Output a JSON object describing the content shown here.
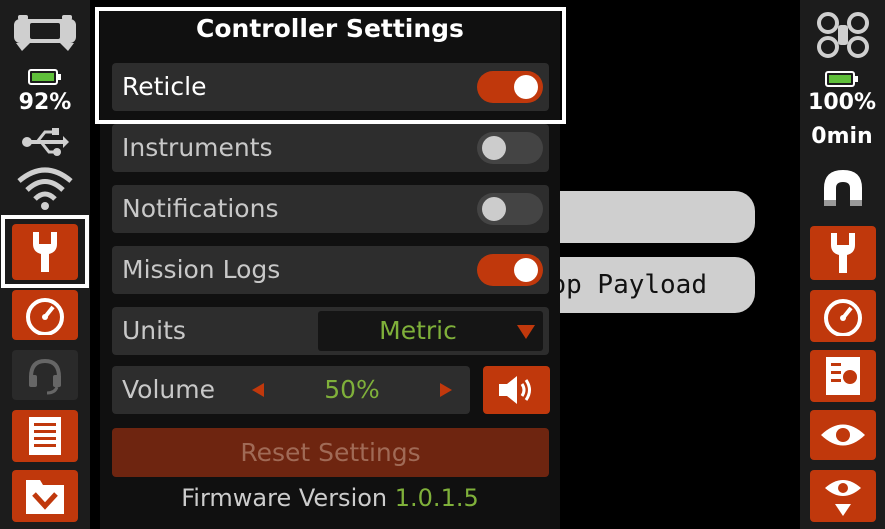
{
  "background": {
    "pill_label": "op Payload"
  },
  "left_bar": {
    "battery_percent": "92%"
  },
  "right_bar": {
    "battery_percent": "100%",
    "flight_time": "0min"
  },
  "settings": {
    "title": "Controller Settings",
    "reticle": {
      "label": "Reticle",
      "enabled": true
    },
    "instruments": {
      "label": "Instruments",
      "enabled": false
    },
    "notifications": {
      "label": "Notifications",
      "enabled": false
    },
    "mission_logs": {
      "label": "Mission Logs",
      "enabled": true
    },
    "units": {
      "label": "Units",
      "value": "Metric"
    },
    "volume": {
      "label": "Volume",
      "value": "50%"
    },
    "reset_label": "Reset Settings",
    "firmware_label": "Firmware Version",
    "firmware_version": "1.0.1.5"
  },
  "colors": {
    "accent": "#c0380c",
    "value_text": "#7fb03a",
    "panel": "#101010",
    "row": "#2d2d2d"
  },
  "icons": [
    "controller-icon",
    "battery-icon",
    "usb-icon",
    "wifi-icon",
    "wrench-icon",
    "gauge-icon",
    "headset-icon",
    "document-icon",
    "download-icon",
    "drone-icon",
    "magnet-icon",
    "drone-list-icon",
    "eye-icon",
    "eye-location-icon",
    "speaker-icon"
  ]
}
